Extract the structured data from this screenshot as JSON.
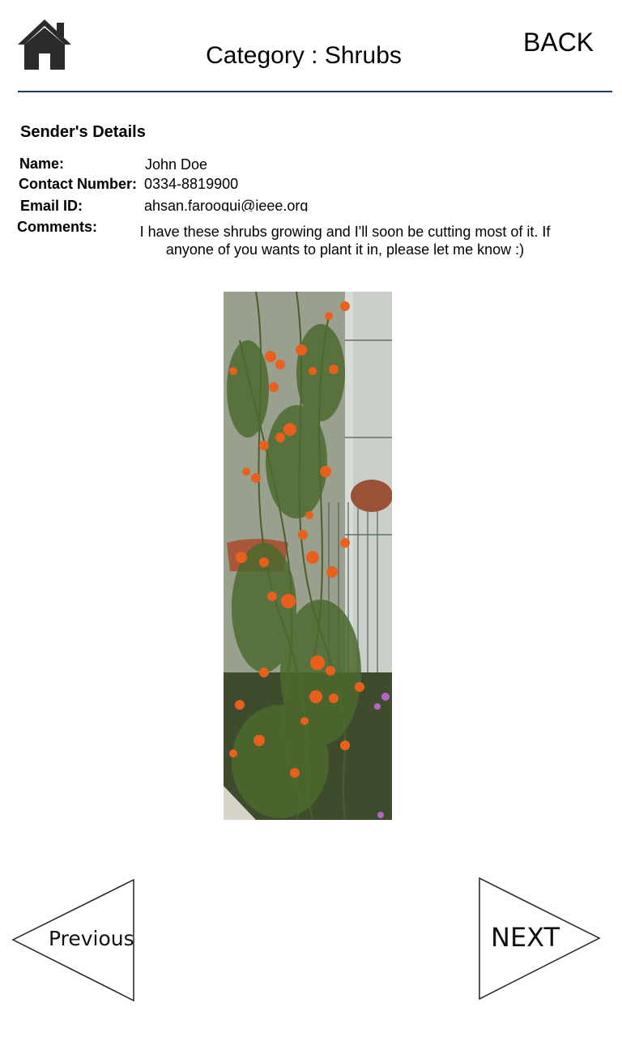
{
  "header": {
    "title": "Category : Shrubs",
    "back_label": "BACK",
    "home_icon": "home-icon"
  },
  "sender": {
    "section_title": "Sender's Details",
    "name_label": "Name:",
    "name_value": "John Doe",
    "contact_label": "Contact Number:",
    "contact_value": "0334-8819900",
    "email_label": "Email ID:",
    "email_value": "ahsan.farooqui@ieee.org",
    "comments_label": "Comments:",
    "comments_value": "I have these shrubs growing and I'll soon be cutting most of it. If anyone of you wants to plant it in, please let me know :)"
  },
  "photo": {
    "subject": "climbing shrub with orange flowers"
  },
  "navigation": {
    "previous_label": "Previous",
    "next_label": "NEXT"
  },
  "colors": {
    "divider": "#1f3a60",
    "flower": "#e8601c",
    "leaf": "#3f5a2a"
  }
}
